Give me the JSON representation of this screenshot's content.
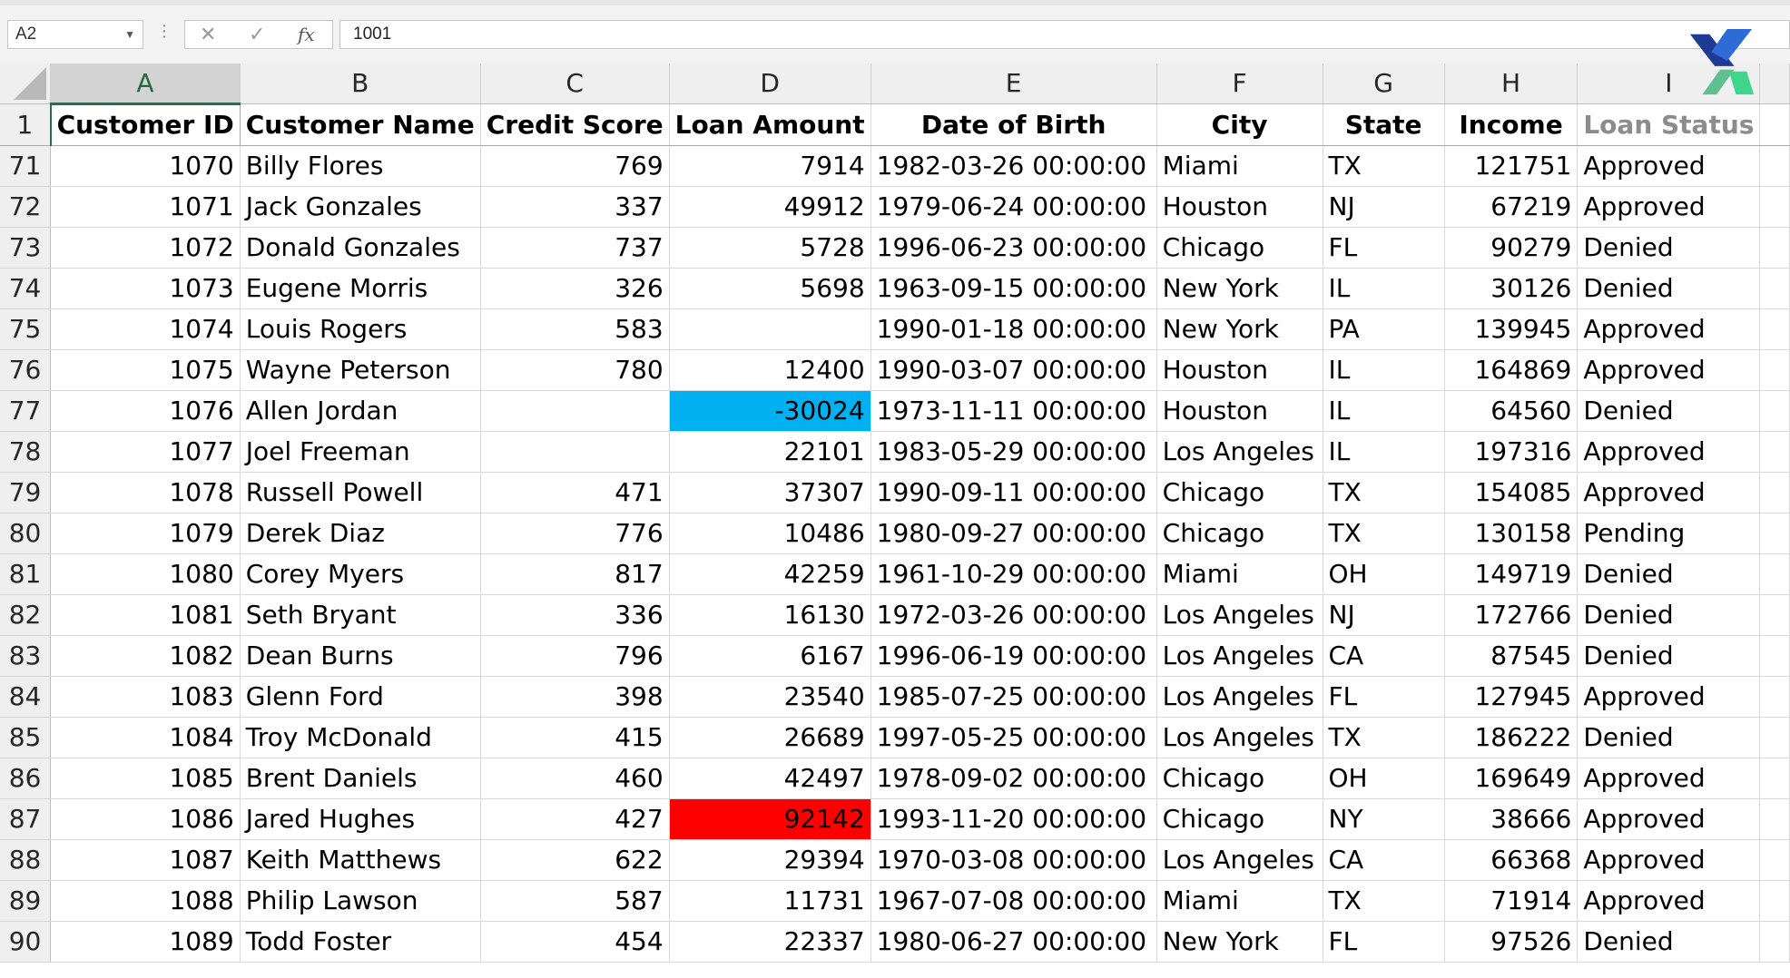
{
  "formula_bar": {
    "name_box": "A2",
    "formula_value": "1001",
    "fx_label": "fx"
  },
  "columns": [
    "A",
    "B",
    "C",
    "D",
    "E",
    "F",
    "G",
    "H",
    "I"
  ],
  "header_row": {
    "row_number": "1",
    "cells": [
      "Customer ID",
      "Customer Name",
      "Credit Score",
      "Loan Amount",
      "Date of Birth",
      "City",
      "State",
      "Income",
      "Loan Status"
    ]
  },
  "rows": [
    {
      "row": "71",
      "cells": [
        "1070",
        "Billy Flores",
        "769",
        "7914",
        "1982-03-26 00:00:00",
        "Miami",
        "TX",
        "121751",
        "Approved"
      ]
    },
    {
      "row": "72",
      "cells": [
        "1071",
        "Jack Gonzales",
        "337",
        "49912",
        "1979-06-24 00:00:00",
        "Houston",
        "NJ",
        "67219",
        "Approved"
      ]
    },
    {
      "row": "73",
      "cells": [
        "1072",
        "Donald Gonzales",
        "737",
        "5728",
        "1996-06-23 00:00:00",
        "Chicago",
        "FL",
        "90279",
        "Denied"
      ]
    },
    {
      "row": "74",
      "cells": [
        "1073",
        "Eugene Morris",
        "326",
        "5698",
        "1963-09-15 00:00:00",
        "New York",
        "IL",
        "30126",
        "Denied"
      ]
    },
    {
      "row": "75",
      "cells": [
        "1074",
        "Louis Rogers",
        "583",
        "",
        "1990-01-18 00:00:00",
        "New York",
        "PA",
        "139945",
        "Approved"
      ]
    },
    {
      "row": "76",
      "cells": [
        "1075",
        "Wayne Peterson",
        "780",
        "12400",
        "1990-03-07 00:00:00",
        "Houston",
        "IL",
        "164869",
        "Approved"
      ]
    },
    {
      "row": "77",
      "cells": [
        "1076",
        "Allen Jordan",
        "",
        "-30024",
        "1973-11-11 00:00:00",
        "Houston",
        "IL",
        "64560",
        "Denied"
      ]
    },
    {
      "row": "78",
      "cells": [
        "1077",
        "Joel Freeman",
        "",
        "22101",
        "1983-05-29 00:00:00",
        "Los Angeles",
        "IL",
        "197316",
        "Approved"
      ]
    },
    {
      "row": "79",
      "cells": [
        "1078",
        "Russell Powell",
        "471",
        "37307",
        "1990-09-11 00:00:00",
        "Chicago",
        "TX",
        "154085",
        "Approved"
      ]
    },
    {
      "row": "80",
      "cells": [
        "1079",
        "Derek Diaz",
        "776",
        "10486",
        "1980-09-27 00:00:00",
        "Chicago",
        "TX",
        "130158",
        "Pending"
      ]
    },
    {
      "row": "81",
      "cells": [
        "1080",
        "Corey Myers",
        "817",
        "42259",
        "1961-10-29 00:00:00",
        "Miami",
        "OH",
        "149719",
        "Denied"
      ]
    },
    {
      "row": "82",
      "cells": [
        "1081",
        "Seth Bryant",
        "336",
        "16130",
        "1972-03-26 00:00:00",
        "Los Angeles",
        "NJ",
        "172766",
        "Denied"
      ]
    },
    {
      "row": "83",
      "cells": [
        "1082",
        "Dean Burns",
        "796",
        "6167",
        "1996-06-19 00:00:00",
        "Los Angeles",
        "CA",
        "87545",
        "Denied"
      ]
    },
    {
      "row": "84",
      "cells": [
        "1083",
        "Glenn Ford",
        "398",
        "23540",
        "1985-07-25 00:00:00",
        "Los Angeles",
        "FL",
        "127945",
        "Approved"
      ]
    },
    {
      "row": "85",
      "cells": [
        "1084",
        "Troy McDonald",
        "415",
        "26689",
        "1997-05-25 00:00:00",
        "Los Angeles",
        "TX",
        "186222",
        "Denied"
      ]
    },
    {
      "row": "86",
      "cells": [
        "1085",
        "Brent Daniels",
        "460",
        "42497",
        "1978-09-02 00:00:00",
        "Chicago",
        "OH",
        "169649",
        "Approved"
      ]
    },
    {
      "row": "87",
      "cells": [
        "1086",
        "Jared Hughes",
        "427",
        "92142",
        "1993-11-20 00:00:00",
        "Chicago",
        "NY",
        "38666",
        "Approved"
      ]
    },
    {
      "row": "88",
      "cells": [
        "1087",
        "Keith Matthews",
        "622",
        "29394",
        "1970-03-08 00:00:00",
        "Los Angeles",
        "CA",
        "66368",
        "Approved"
      ]
    },
    {
      "row": "89",
      "cells": [
        "1088",
        "Philip Lawson",
        "587",
        "11731",
        "1967-07-08 00:00:00",
        "Miami",
        "TX",
        "71914",
        "Approved"
      ]
    },
    {
      "row": "90",
      "cells": [
        "1089",
        "Todd Foster",
        "454",
        "22337",
        "1980-06-27 00:00:00",
        "New York",
        "FL",
        "97526",
        "Denied"
      ]
    }
  ],
  "highlights": [
    {
      "row": "77",
      "column": "D",
      "color": "#00b0f0"
    },
    {
      "row": "87",
      "column": "D",
      "color": "#ff0000"
    }
  ],
  "colors": {
    "selection_accent": "#217346",
    "header_bg": "#efefef",
    "gridline": "#d9d9d9"
  },
  "icons": {
    "cancel": "close-icon",
    "enter": "check-icon",
    "function": "fx-icon",
    "logo": "x-logo-icon"
  }
}
